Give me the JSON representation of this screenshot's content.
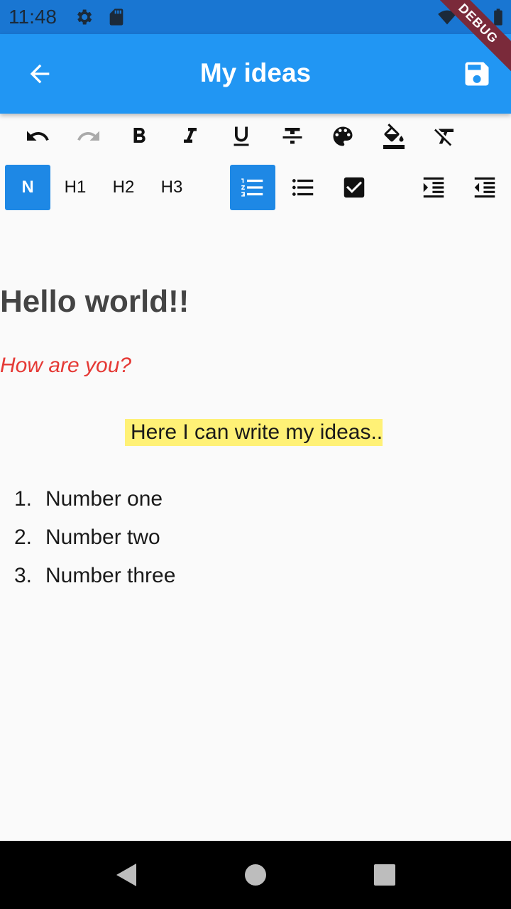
{
  "status_bar": {
    "time": "11:48",
    "icons": [
      "gear-icon",
      "sd-card-icon",
      "wifi-icon",
      "battery-icon"
    ],
    "ribbon": "DEBUG"
  },
  "app_bar": {
    "title": "My ideas",
    "icons": [
      "back-arrow-icon",
      "save-icon"
    ]
  },
  "toolbar": {
    "row1_icons": [
      "undo-icon",
      "redo-icon",
      "bold-icon",
      "italic-icon",
      "underline-icon",
      "strikethrough-icon",
      "palette-icon",
      "fill-color-icon",
      "clear-format-icon"
    ],
    "headings": [
      "N",
      "H1",
      "H2",
      "H3"
    ],
    "active_heading": "N",
    "row2_icons": [
      "numbered-list-icon",
      "bulleted-list-icon",
      "checkbox-icon",
      "indent-icon",
      "outdent-icon"
    ],
    "active_list": "numbered-list-icon"
  },
  "editor": {
    "heading": "Hello world!!",
    "italic_line": "How are you?",
    "highlight_line": "Here I can write my ideas..",
    "list": [
      {
        "num": "1.",
        "text": "Number one"
      },
      {
        "num": "2.",
        "text": "Number two"
      },
      {
        "num": "3.",
        "text": "Number three"
      }
    ]
  },
  "colors": {
    "primary": "#2196f3",
    "status_bar": "#1976d2",
    "active_button": "#1e88e5",
    "italic_text": "#e53935",
    "highlight": "#fff176"
  }
}
